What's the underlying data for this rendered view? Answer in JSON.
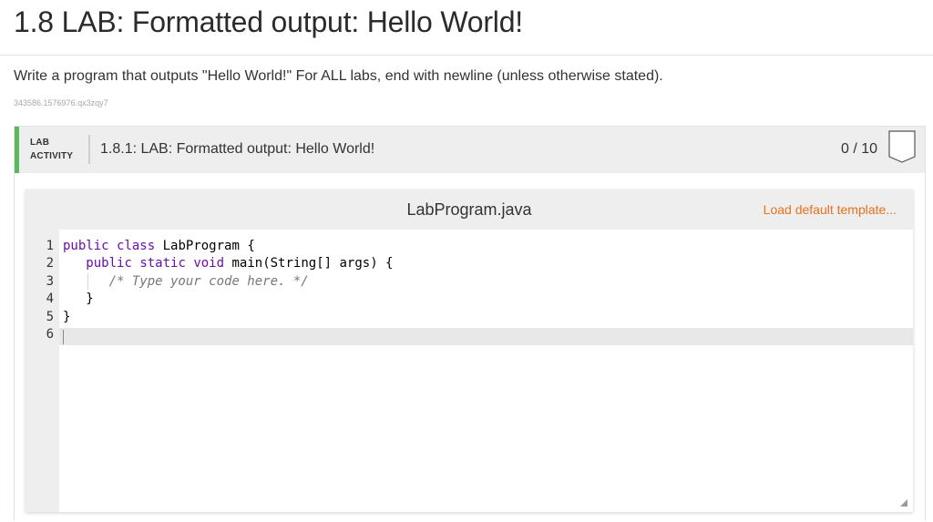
{
  "page": {
    "title": "1.8 LAB: Formatted output: Hello World!",
    "instructions": "Write a program that outputs \"Hello World!\" For ALL labs, end with newline (unless otherwise stated).",
    "code_id": "343586.1576976.qx3zqy7"
  },
  "activity": {
    "tag_line1": "LAB",
    "tag_line2": "ACTIVITY",
    "title": "1.8.1: LAB: Formatted output: Hello World!",
    "score": "0 / 10",
    "accent_color": "#5cb85c"
  },
  "editor": {
    "file_name": "LabProgram.java",
    "load_template_label": "Load default template...",
    "load_template_color": "#e8711b",
    "line_numbers": [
      "1",
      "2",
      "3",
      "4",
      "5",
      "6"
    ],
    "lines": [
      "public class LabProgram {",
      "   public static void main(String[] args) {",
      "      /* Type your code here. */",
      "   }",
      "}",
      ""
    ]
  }
}
